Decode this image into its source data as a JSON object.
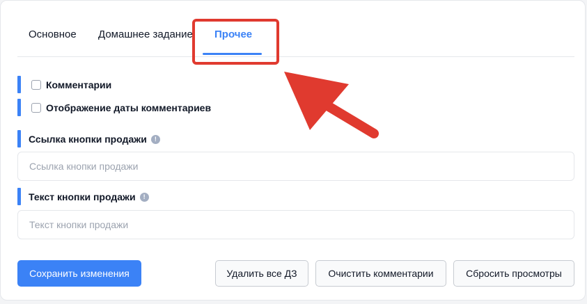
{
  "tabs": [
    {
      "label": "Основное"
    },
    {
      "label": "Домашнее задание"
    },
    {
      "label": "Прочее",
      "active": true
    }
  ],
  "checkboxes": [
    {
      "label": "Комментарии",
      "checked": false
    },
    {
      "label": "Отображение даты комментариев",
      "checked": false
    }
  ],
  "fields": {
    "sale_link": {
      "label": "Ссылка кнопки продажи",
      "placeholder": "Ссылка кнопки продажи",
      "value": ""
    },
    "sale_text": {
      "label": "Текст кнопки продажи",
      "placeholder": "Текст кнопки продажи",
      "value": ""
    }
  },
  "info_icon_glyph": "!",
  "buttons": {
    "save": "Сохранить изменения",
    "delete_hw": "Удалить все ДЗ",
    "clear_comments": "Очистить комментарии",
    "reset_views": "Сбросить просмотры"
  },
  "colors": {
    "accent": "#3b82f6",
    "annotation": "#e03a2f"
  }
}
